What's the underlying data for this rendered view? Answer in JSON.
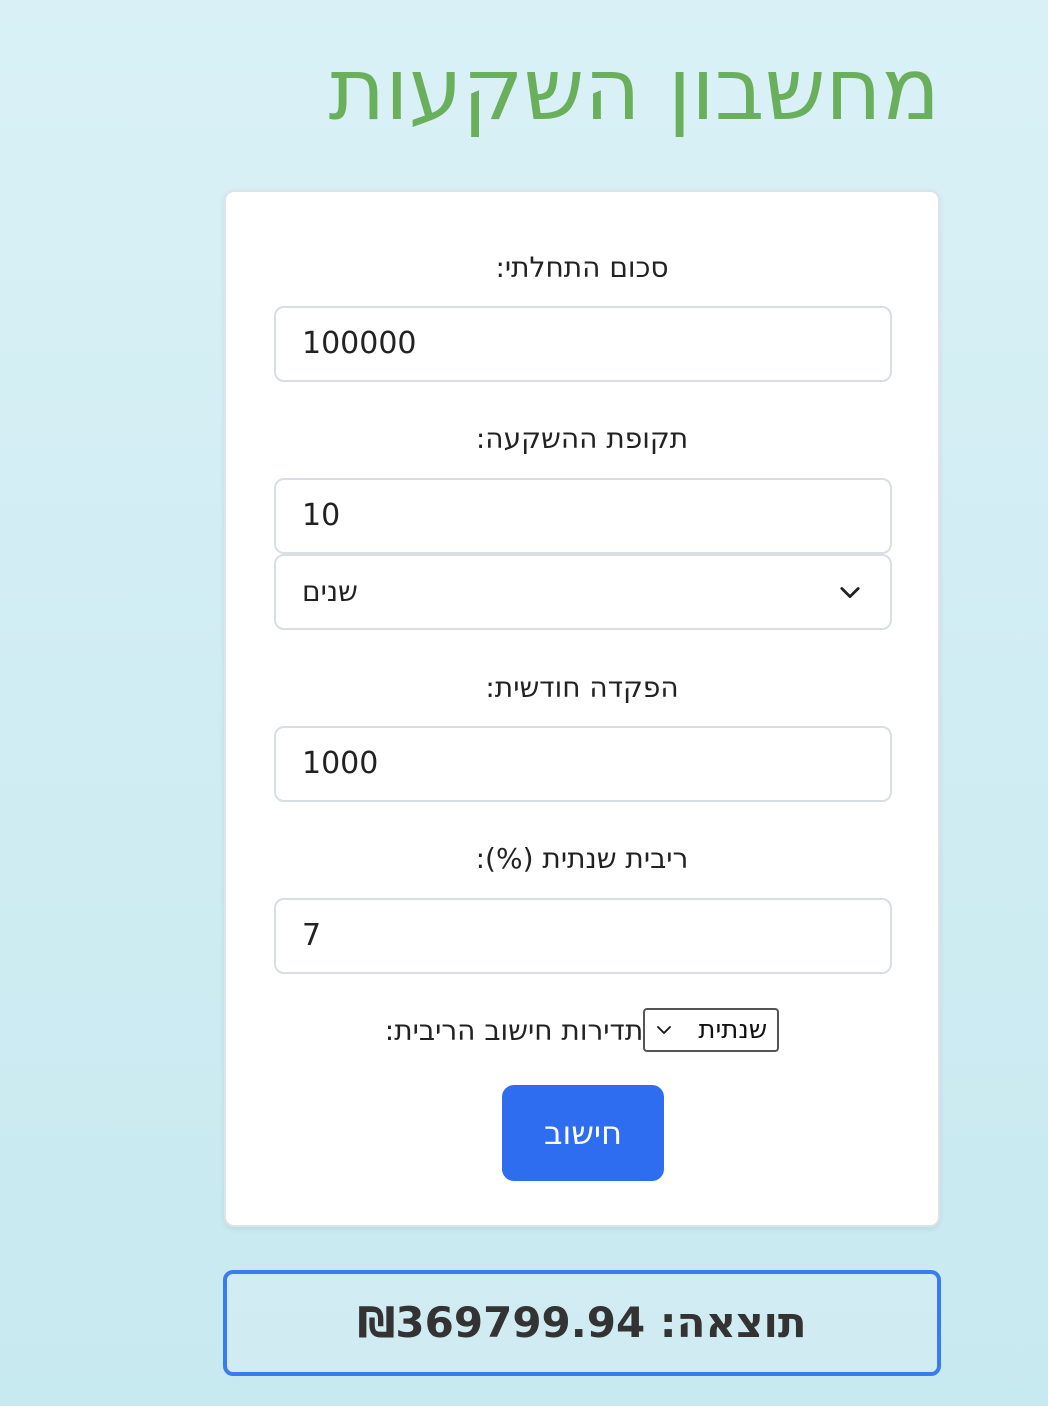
{
  "title": "מחשבון השקעות",
  "form": {
    "initial_amount": {
      "label": "סכום התחלתי:",
      "value": "100000"
    },
    "period": {
      "label": "תקופת ההשקעה:",
      "value": "10",
      "unit": "שנים"
    },
    "monthly_deposit": {
      "label": "הפקדה חודשית:",
      "value": "1000"
    },
    "interest_rate": {
      "label": "ריבית שנתית (%):",
      "value": "7"
    },
    "compound_frequency": {
      "label": "תדירות חישוב הריבית:",
      "value": "שנתית"
    },
    "calculate_label": "חישוב"
  },
  "result": {
    "text": "תוצאה: ₪369799.94"
  }
}
